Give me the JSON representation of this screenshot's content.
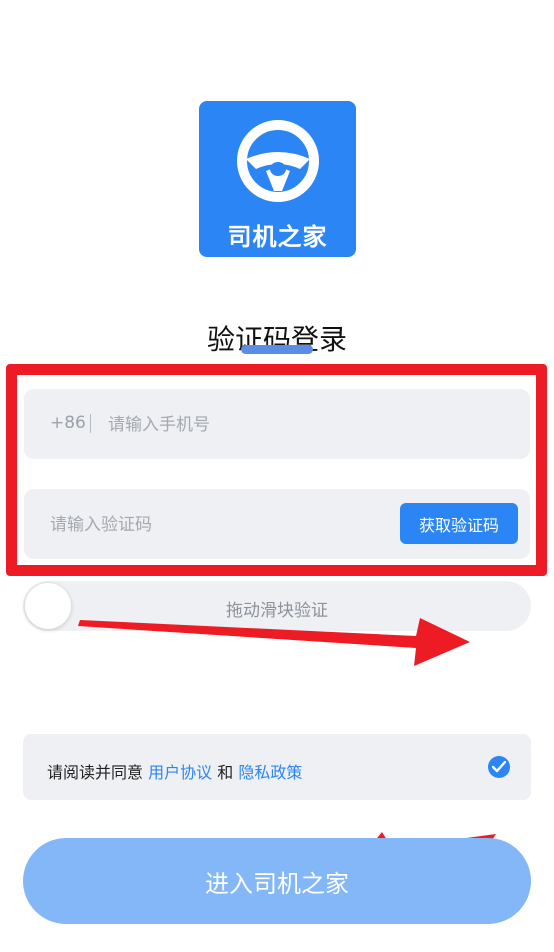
{
  "logo": {
    "text": "司机之家",
    "icon": "steering-wheel-icon",
    "bg_color": "#2b85f4"
  },
  "login": {
    "title": "验证码登录"
  },
  "phone": {
    "prefix": "+86",
    "placeholder": "请输入手机号",
    "value": ""
  },
  "code": {
    "placeholder": "请输入验证码",
    "value": "",
    "button_label": "获取验证码"
  },
  "slider": {
    "label": "拖动滑块验证"
  },
  "agreement": {
    "prefix": "请阅读并同意",
    "user_agreement": "用户协议",
    "conjunction": "和",
    "privacy_policy": "隐私政策",
    "checked": true
  },
  "submit": {
    "label": "进入司机之家"
  },
  "annotation": {
    "color": "#ed1c24"
  }
}
